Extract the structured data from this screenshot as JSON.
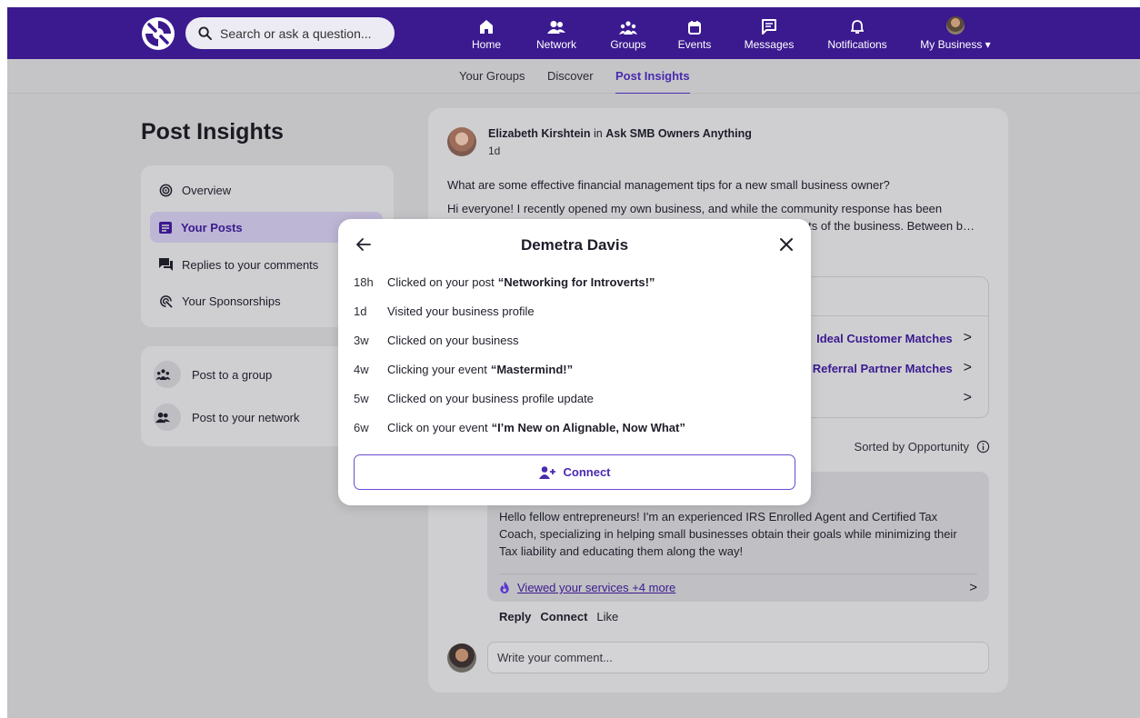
{
  "search": {
    "placeholder": "Search or ask a question..."
  },
  "nav": {
    "items": [
      {
        "label": "Home",
        "icon": "home-icon"
      },
      {
        "label": "Network",
        "icon": "network-icon"
      },
      {
        "label": "Groups",
        "icon": "groups-icon"
      },
      {
        "label": "Events",
        "icon": "calendar-icon"
      },
      {
        "label": "Messages",
        "icon": "messages-icon"
      },
      {
        "label": "Notifications",
        "icon": "bell-icon"
      },
      {
        "label": "My Business ▾",
        "icon": "avatar"
      }
    ],
    "active": "Groups"
  },
  "subnav": {
    "tabs": [
      "Your Groups",
      "Discover",
      "Post Insights"
    ],
    "active": "Post Insights"
  },
  "sidebar": {
    "title": "Post Insights",
    "items": [
      {
        "label": "Overview",
        "icon": "overview-icon"
      },
      {
        "label": "Your Posts",
        "icon": "posts-icon"
      },
      {
        "label": "Replies to your comments",
        "icon": "replies-icon"
      },
      {
        "label": "Your Sponsorships",
        "icon": "sponsorship-icon"
      }
    ],
    "post_actions": [
      {
        "label": "Post to a group",
        "icon": "groups-icon"
      },
      {
        "label": "Post to your network",
        "icon": "network-icon"
      }
    ]
  },
  "post": {
    "author": "Elizabeth Kirshtein",
    "in_word": "in",
    "group": "Ask SMB Owners Anything",
    "time": "1d",
    "question": "What are some effective financial management tips for a new small business owner?",
    "body_line1": "Hi everyone! I recently opened my own business, and while the community response has been",
    "body_line2": "ts of the business. Between b…",
    "matches": [
      {
        "label": "Ideal Customer Matches",
        "chevron": ">"
      },
      {
        "label": "Referral Partner Matches",
        "chevron": ">"
      },
      {
        "label": "",
        "chevron": ">"
      }
    ],
    "sorted_by": "Sorted by Opportunity",
    "comment": {
      "text": "Hello fellow entrepreneurs! I'm an experienced IRS Enrolled Agent and Certified Tax Coach, specializing in helping small businesses obtain their goals while minimizing their Tax liability and educating them along the way!",
      "viewed": "Viewed your services +4 more",
      "chevron": ">"
    },
    "actions": {
      "reply": "Reply",
      "connect": "Connect",
      "like": "Like"
    },
    "comment_placeholder": "Write your comment..."
  },
  "modal": {
    "title": "Demetra Davis",
    "activities": [
      {
        "time": "18h",
        "text": "Clicked on your post",
        "bold": "“Networking for Introverts!”"
      },
      {
        "time": "1d",
        "text": "Visited your business profile",
        "bold": ""
      },
      {
        "time": "3w",
        "text": "Clicked on your business",
        "bold": ""
      },
      {
        "time": "4w",
        "text": "Clicking your event",
        "bold": "“Mastermind!”"
      },
      {
        "time": "5w",
        "text": "Clicked on your business profile update",
        "bold": ""
      },
      {
        "time": "6w",
        "text": "Click on your event",
        "bold": "“I’m New on Alignable, Now What”"
      }
    ],
    "connect_label": "Connect"
  },
  "colors": {
    "brand": "#3b1a8f",
    "accent": "#4a2ab0",
    "overlay": "#c3c3c6"
  }
}
